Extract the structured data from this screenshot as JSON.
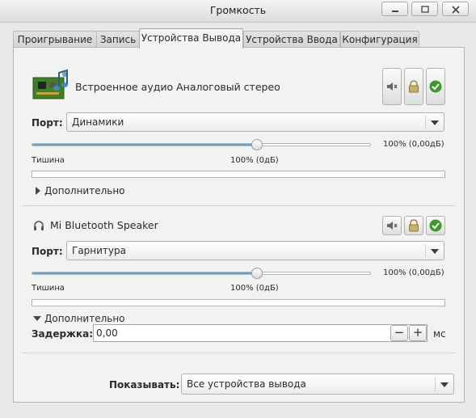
{
  "window": {
    "title": "Громкость"
  },
  "tabs": [
    {
      "label": "Проигрывание"
    },
    {
      "label": "Запись"
    },
    {
      "label": "Устройства Вывода"
    },
    {
      "label": "Устройства Ввода"
    },
    {
      "label": "Конфигурация"
    }
  ],
  "active_tab": "Устройства Вывода",
  "devices": [
    {
      "name": "Встроенное аудио Аналоговый стерео",
      "icon": "sound-card-icon",
      "port_label": "Порт:",
      "port_value": "Динамики",
      "volume_fraction": 1.0,
      "volume_text": "100% (0,00дБ)",
      "silence_label": "Тишина",
      "mark_label": "100% (0дБ)",
      "advanced_label": "Дополнительно",
      "advanced_expanded": false
    },
    {
      "name": "Mi Bluetooth Speaker",
      "icon": "headset-icon",
      "port_label": "Порт:",
      "port_value": "Гарнитура",
      "volume_fraction": 1.0,
      "volume_text": "100% (0,00дБ)",
      "silence_label": "Тишина",
      "mark_label": "100% (0дБ)",
      "advanced_label": "Дополнительно",
      "advanced_expanded": true,
      "latency_label": "Задержка:",
      "latency_value": "0,00",
      "latency_unit": "мс"
    }
  ],
  "footer": {
    "show_label": "Показывать:",
    "show_value": "Все устройства вывода"
  },
  "colors": {
    "accent": "#62a0d8",
    "default_check": "#3a9b2b"
  }
}
